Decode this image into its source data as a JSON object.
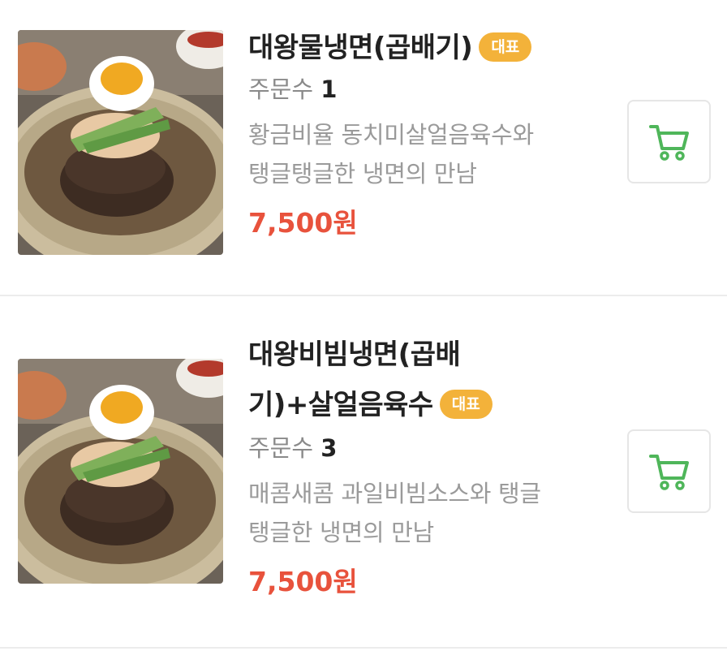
{
  "menu": {
    "items": [
      {
        "name": "대왕물냉면(곱배기)",
        "badge": "대표",
        "orders_label": "주문수",
        "orders_count": "1",
        "description_line1": "황금비율 동치미살얼음육수와",
        "description_line2": "탱글탱글한 냉면의 만남",
        "price": "7,500원",
        "thumbnail_icon": "naengmyeon-photo",
        "cart_icon": "cart-icon"
      },
      {
        "name_line1": "대왕비빔냉면(곱배",
        "name_line2": "기)+살얼음육수",
        "badge": "대표",
        "orders_label": "주문수",
        "orders_count": "3",
        "description_line1": "매콤새콤 과일비빔소스와 탱글",
        "description_line2": "탱글한 냉면의 만남",
        "price": "7,500원",
        "thumbnail_icon": "naengmyeon-photo",
        "cart_icon": "cart-icon"
      }
    ]
  },
  "colors": {
    "badge": "#f3b23a",
    "price": "#e8523c",
    "cart": "#4fb65a",
    "divider": "#ececec"
  }
}
